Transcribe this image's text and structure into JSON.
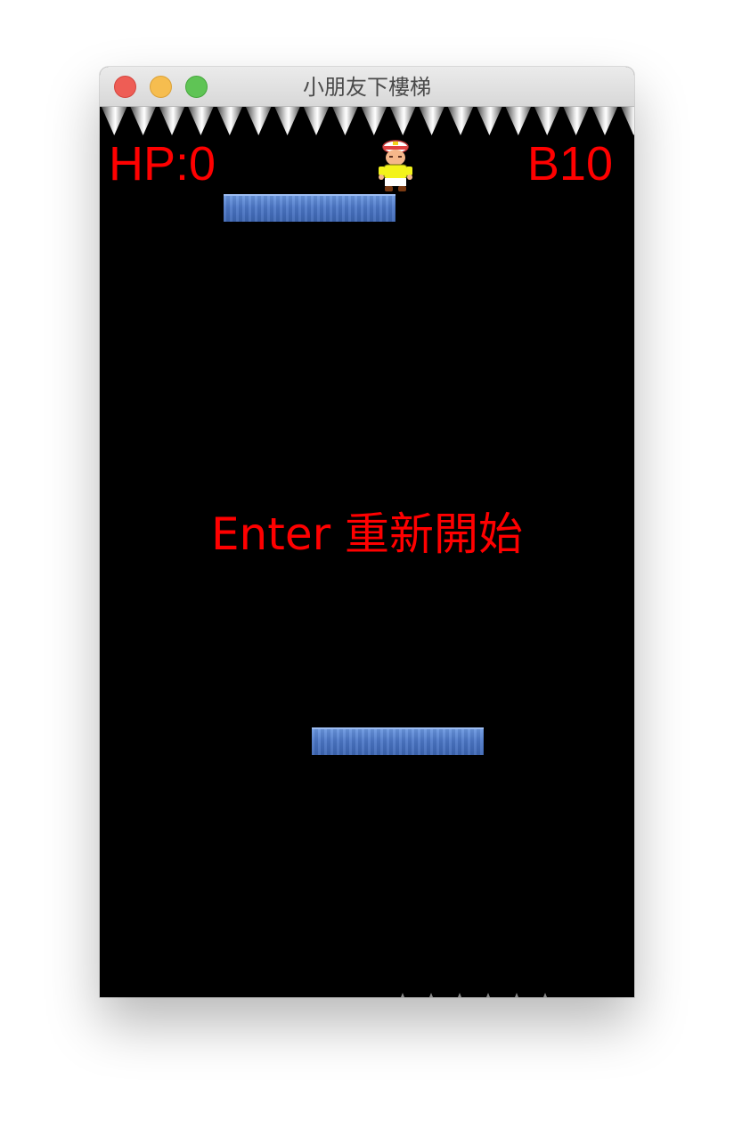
{
  "window": {
    "title": "小朋友下樓梯"
  },
  "hud": {
    "hp": "HP:0",
    "floor": "B10"
  },
  "overlay": {
    "message": "Enter 重新開始"
  },
  "colors": {
    "hud_text": "#ff0000",
    "platform": "#4d78c8",
    "background": "#000000"
  }
}
